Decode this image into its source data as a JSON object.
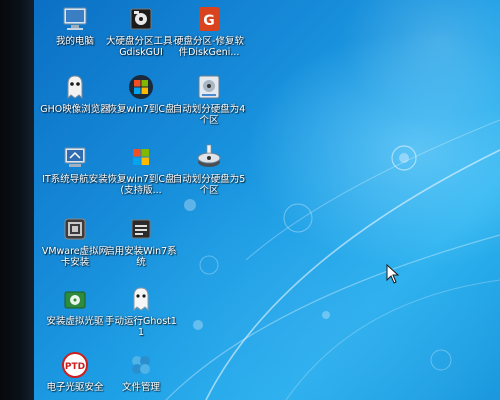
{
  "desktop": {
    "icons": [
      {
        "label": "我的电脑",
        "icon": "computer-icon"
      },
      {
        "label": "大硬盘分区工具-GdiskGUI",
        "icon": "disk-tool-icon"
      },
      {
        "label": "硬盘分区-修复软件DiskGeni...",
        "icon": "diskgenius-icon"
      },
      {
        "label": "GHO映像浏览器",
        "icon": "ghost-viewer-icon"
      },
      {
        "label": "恢复win7到C盘",
        "icon": "windows-restore-icon"
      },
      {
        "label": "自动划分硬盘为4个区",
        "icon": "auto-partition-icon"
      },
      {
        "label": "IT系统导航安装",
        "icon": "it-navigation-icon"
      },
      {
        "label": "恢复win7到C盘(支持版...",
        "icon": "windows-restore-icon"
      },
      {
        "label": "自动划分硬盘为5个区",
        "icon": "auto-partition-icon"
      },
      {
        "label": "VMware虚拟网卡安装",
        "icon": "vmware-icon"
      },
      {
        "label": "启用安装Win7系统",
        "icon": "installer-icon"
      },
      {
        "label": "安装虚拟光驱",
        "icon": "virtual-drive-icon"
      },
      {
        "label": "手动运行Ghost11",
        "icon": "ghost-icon"
      },
      {
        "label": "电子光驱安全",
        "icon": "ptd-icon"
      },
      {
        "label": "文件管理",
        "icon": "file-manager-icon"
      }
    ]
  },
  "colors": {
    "wallpaper_dark": "#0b6fc4",
    "wallpaper_light": "#2bb4f0",
    "label_text": "#ffffff",
    "bezel": "#06080c"
  }
}
